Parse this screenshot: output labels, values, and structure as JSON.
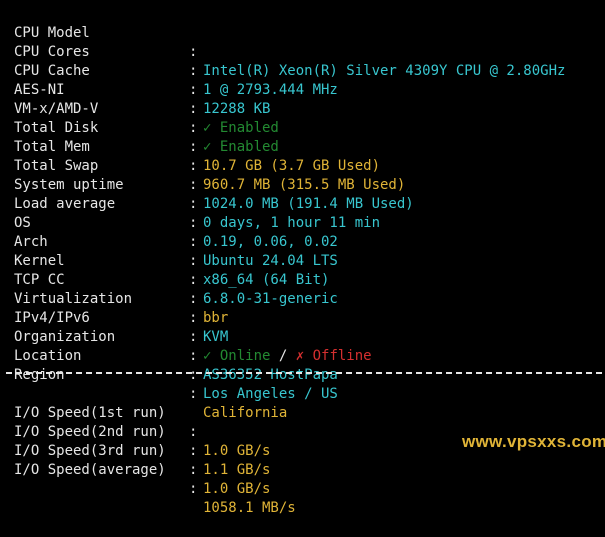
{
  "colors": {
    "background": "#000000",
    "label": "#e6e6e6",
    "cyan": "#38c6cf",
    "yellow": "#e0b437",
    "green": "#238a32",
    "red": "#d42f2f"
  },
  "separator": ":",
  "system_info": {
    "cpu_model": {
      "label": "CPU Model",
      "value": "Intel(R) Xeon(R) Silver 4309Y CPU @ 2.80GHz"
    },
    "cpu_cores": {
      "label": "CPU Cores",
      "value": "1 @ 2793.444 MHz"
    },
    "cpu_cache": {
      "label": "CPU Cache",
      "value": "12288 KB"
    },
    "aes_ni": {
      "label": "AES-NI",
      "value": "✓ Enabled"
    },
    "vmx": {
      "label": "VM-x/AMD-V",
      "value": "✓ Enabled"
    },
    "total_disk": {
      "label": "Total Disk",
      "value": "10.7 GB (3.7 GB Used)"
    },
    "total_mem": {
      "label": "Total Mem",
      "value": "960.7 MB (315.5 MB Used)"
    },
    "total_swap": {
      "label": "Total Swap",
      "value": "1024.0 MB (191.4 MB Used)"
    },
    "uptime": {
      "label": "System uptime",
      "value": "0 days, 1 hour 11 min"
    },
    "load": {
      "label": "Load average",
      "value": "0.19, 0.06, 0.02"
    },
    "os": {
      "label": "OS",
      "value": "Ubuntu 24.04 LTS"
    },
    "arch": {
      "label": "Arch",
      "value": "x86_64 (64 Bit)"
    },
    "kernel": {
      "label": "Kernel",
      "value": "6.8.0-31-generic"
    },
    "tcp_cc": {
      "label": "TCP CC",
      "value": "bbr"
    },
    "virt": {
      "label": "Virtualization",
      "value": "KVM"
    },
    "ip": {
      "label": "IPv4/IPv6",
      "ipv4_value": "✓ Online",
      "slash": " / ",
      "ipv6_value": "✗ Offline"
    },
    "org": {
      "label": "Organization",
      "value": "AS36352 HostPapa"
    },
    "location": {
      "label": "Location",
      "value": "Los Angeles / US"
    },
    "region": {
      "label": "Region",
      "value": "California"
    }
  },
  "io_speed": {
    "run1": {
      "label": "I/O Speed(1st run)",
      "value": "1.0 GB/s"
    },
    "run2": {
      "label": "I/O Speed(2nd run)",
      "value": "1.1 GB/s"
    },
    "run3": {
      "label": "I/O Speed(3rd run)",
      "value": "1.0 GB/s"
    },
    "average": {
      "label": "I/O Speed(average)",
      "value": "1058.1 MB/s"
    }
  },
  "watermark": "www.vpsxxs.com"
}
